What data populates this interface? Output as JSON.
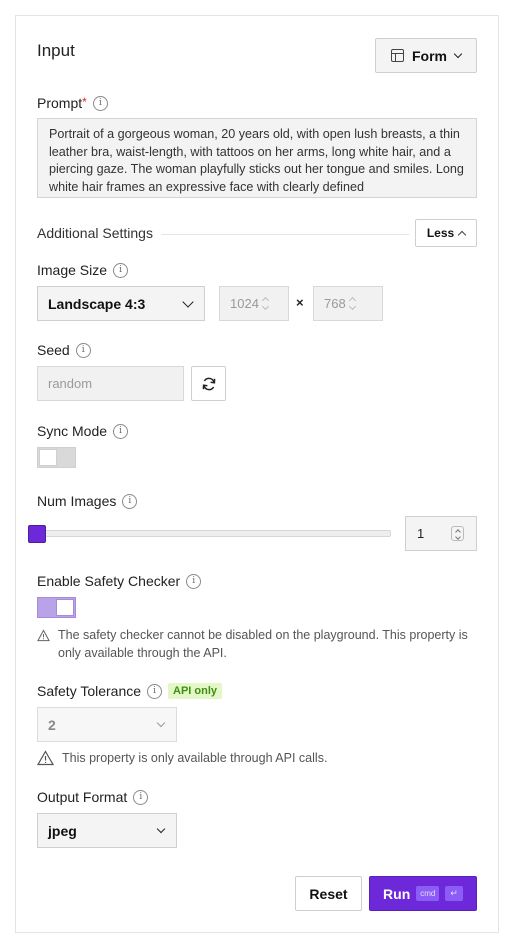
{
  "header": {
    "title": "Input",
    "mode_button": "Form"
  },
  "prompt": {
    "label": "Prompt",
    "required_mark": "*",
    "value": "Portrait of a gorgeous woman, 20 years old, with open lush breasts, a thin leather bra, waist-length, with tattoos on her arms, long white hair, and a piercing gaze. The woman playfully sticks out her tongue and smiles. Long white hair frames an expressive face with clearly defined"
  },
  "additional": {
    "label": "Additional Settings",
    "toggle_label": "Less"
  },
  "image_size": {
    "label": "Image Size",
    "selected": "Landscape 4:3",
    "width": "1024",
    "height": "768",
    "times": "×"
  },
  "seed": {
    "label": "Seed",
    "placeholder": "random"
  },
  "sync_mode": {
    "label": "Sync Mode",
    "enabled": false
  },
  "num_images": {
    "label": "Num Images",
    "value": "1",
    "slider_fraction": 0
  },
  "safety_checker": {
    "label": "Enable Safety Checker",
    "enabled": true,
    "warning": "The safety checker cannot be disabled on the playground. This property is only available through the API."
  },
  "safety_tolerance": {
    "label": "Safety Tolerance",
    "badge": "API only",
    "selected": "2",
    "warning": "This property is only available through API calls."
  },
  "output_format": {
    "label": "Output Format",
    "selected": "jpeg"
  },
  "footer": {
    "reset_label": "Reset",
    "run_label": "Run",
    "kbd_cmd": "cmd",
    "kbd_enter": "↵"
  },
  "colors": {
    "accent": "#6d28d9",
    "accent_light": "#b9a2e8",
    "badge_bg": "#e3f7c7",
    "badge_fg": "#3f8f12"
  },
  "icons": [
    "form-layout-icon",
    "info-icon",
    "refresh-icon",
    "warning-icon",
    "chevron-down-icon",
    "chevron-up-icon"
  ]
}
